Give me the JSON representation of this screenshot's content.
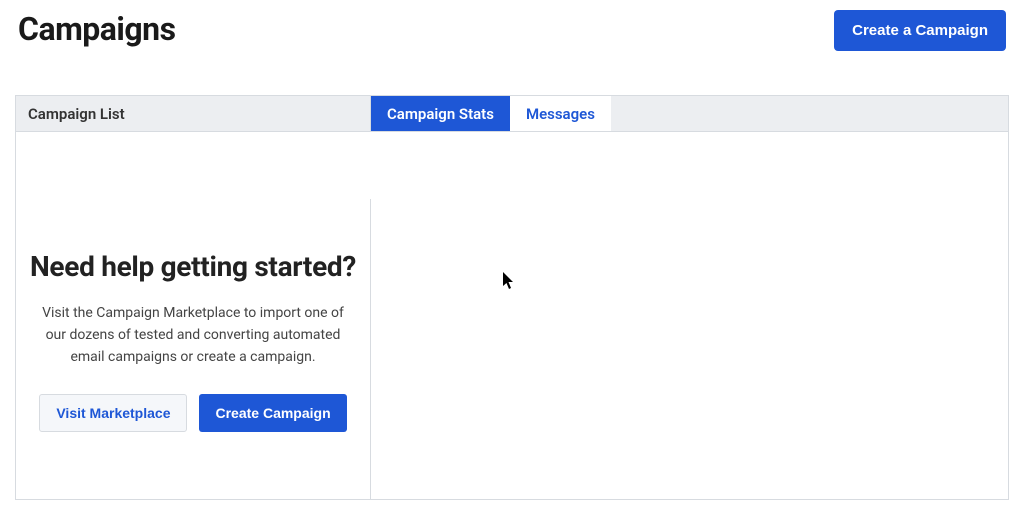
{
  "header": {
    "title": "Campaigns",
    "create_button": "Create a Campaign"
  },
  "sidebar": {
    "header": "Campaign List",
    "onboard_heading": "Need help getting started?",
    "onboard_text": "Visit the Campaign Marketplace to import one of our dozens of tested and converting automated email campaigns or create a campaign.",
    "visit_button": "Visit Marketplace",
    "create_button": "Create Campaign"
  },
  "tabs": {
    "stats": "Campaign Stats",
    "messages": "Messages"
  }
}
